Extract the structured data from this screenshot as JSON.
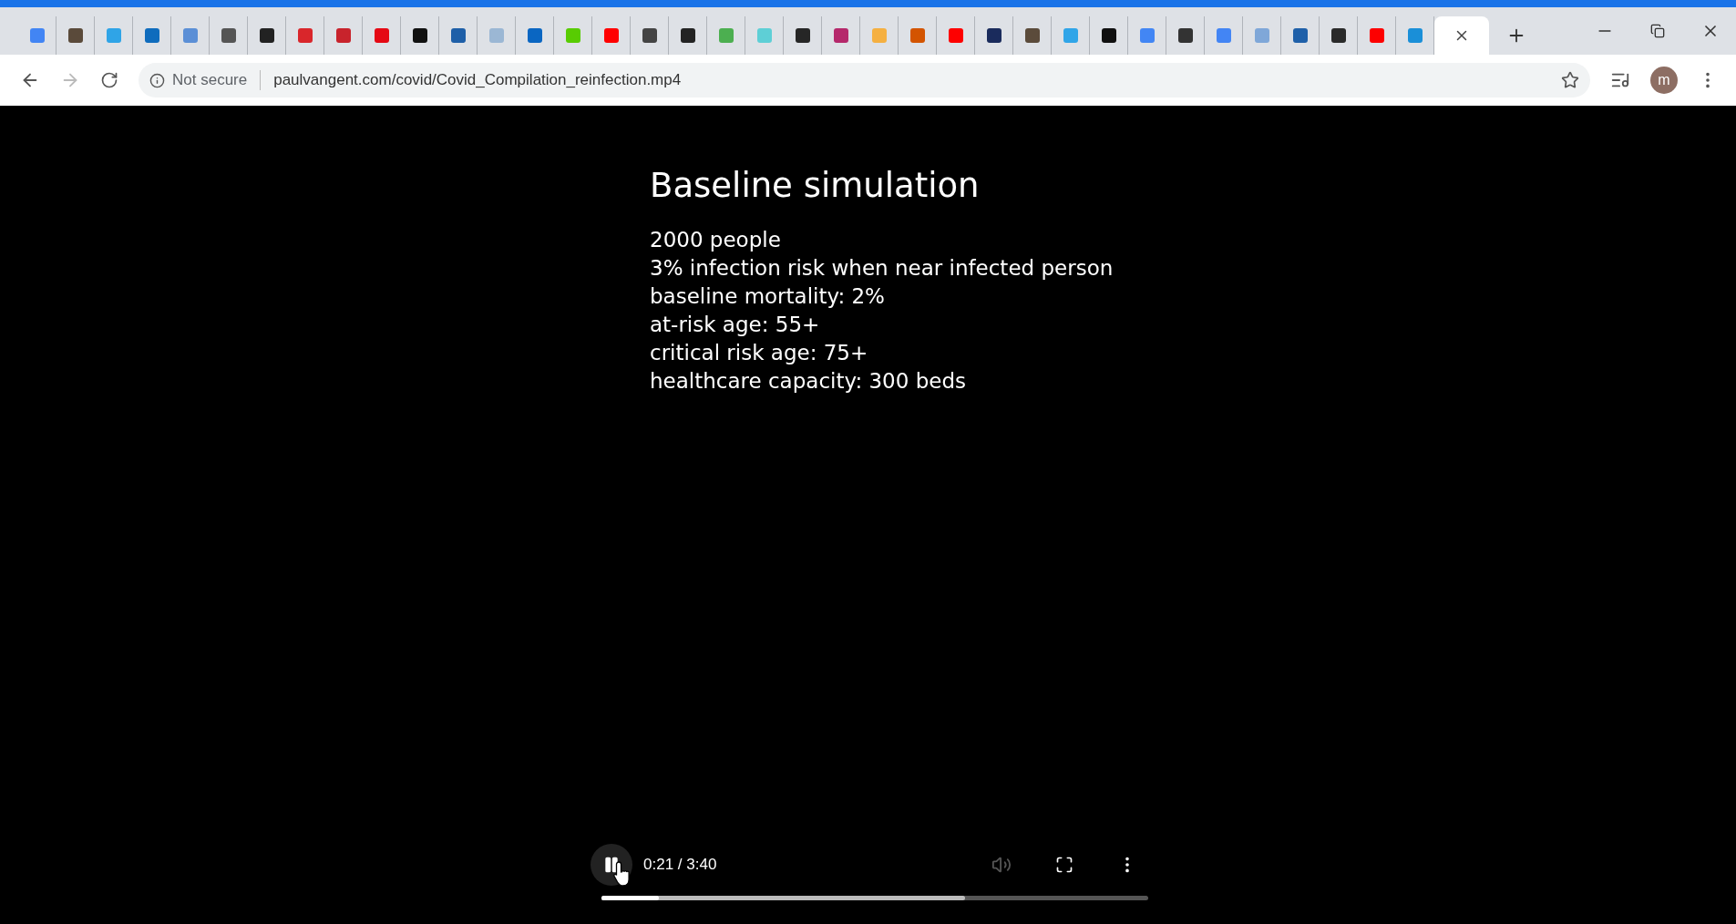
{
  "tabs": [
    {
      "color": "#4285f4",
      "selected": false
    },
    {
      "color": "#5a4a3a",
      "selected": false
    },
    {
      "color": "#2fa4e7",
      "selected": false
    },
    {
      "color": "#0f6cbd",
      "selected": false
    },
    {
      "color": "#5b8fd6",
      "selected": false
    },
    {
      "color": "#555555",
      "selected": false
    },
    {
      "color": "#222222",
      "selected": false
    },
    {
      "color": "#d9262b",
      "selected": false
    },
    {
      "color": "#c8232c",
      "selected": false
    },
    {
      "color": "#e50914",
      "selected": false
    },
    {
      "color": "#111111",
      "selected": false
    },
    {
      "color": "#1e5fa8",
      "selected": false
    },
    {
      "color": "#9bb7d4",
      "selected": false
    },
    {
      "color": "#0a66c2",
      "selected": false
    },
    {
      "color": "#58cc02",
      "selected": false
    },
    {
      "color": "#ff0000",
      "selected": false
    },
    {
      "color": "#444444",
      "selected": false
    },
    {
      "color": "#232323",
      "selected": false
    },
    {
      "color": "#4caf50",
      "selected": false
    },
    {
      "color": "#5ecfd6",
      "selected": false
    },
    {
      "color": "#262626",
      "selected": false
    },
    {
      "color": "#b5286b",
      "selected": false
    },
    {
      "color": "#f5b041",
      "selected": false
    },
    {
      "color": "#d35400",
      "selected": false
    },
    {
      "color": "#fe0000",
      "selected": false
    },
    {
      "color": "#1a2b5c",
      "selected": false
    },
    {
      "color": "#5b4b3b",
      "selected": false
    },
    {
      "color": "#30a5e8",
      "selected": false
    },
    {
      "color": "#101010",
      "selected": false
    },
    {
      "color": "#4286f4",
      "selected": false
    },
    {
      "color": "#333333",
      "selected": false
    },
    {
      "color": "#4385f4",
      "selected": false
    },
    {
      "color": "#7fa7d8",
      "selected": false
    },
    {
      "color": "#1f60a9",
      "selected": false
    },
    {
      "color": "#2a2a2a",
      "selected": false
    },
    {
      "color": "#fd0000",
      "selected": false
    },
    {
      "color": "#1a8fd8",
      "selected": false
    },
    {
      "selected": true
    }
  ],
  "address_bar": {
    "security": "Not secure",
    "url": "paulvangent.com/covid/Covid_Compilation_reinfection.mp4",
    "profile": "m"
  },
  "video": {
    "title": "Baseline simulation",
    "lines": [
      "2000 people",
      "3% infection risk when near infected person",
      "baseline mortality: 2%",
      "at-risk age: 55+",
      "critical risk age: 75+",
      "healthcare capacity: 300 beds"
    ],
    "playing": true,
    "time": "0:21 / 3:40",
    "progress": {
      "level": 0.105
    },
    "buffered": {
      "level": 0.665
    }
  }
}
